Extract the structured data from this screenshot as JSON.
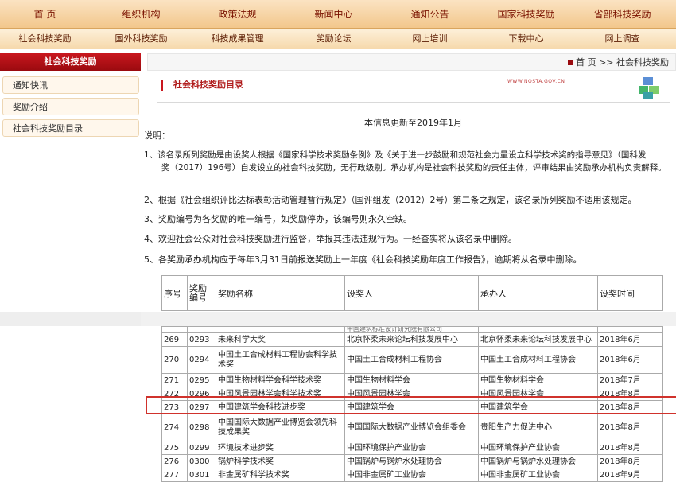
{
  "nav_primary": [
    "首 页",
    "组织机构",
    "政策法规",
    "新闻中心",
    "通知公告",
    "国家科技奖励",
    "省部科技奖励"
  ],
  "nav_secondary": [
    "社会科技奖励",
    "国外科技奖励",
    "科技成果管理",
    "奖励论坛",
    "网上培训",
    "下载中心",
    "网上调查"
  ],
  "sidebar": {
    "title": "社会科技奖励",
    "items": [
      "通知快讯",
      "奖励介绍",
      "社会科技奖励目录"
    ]
  },
  "breadcrumb": {
    "home": "首 页",
    "sep": ">>",
    "current": "社会科技奖励"
  },
  "page_title": "社会科技奖励目录",
  "site_url": "WWW.NOSTA.GOV.CN",
  "update_note": "本信息更新至2019年1月",
  "notes_label": "说明：",
  "notes": [
    "1、该名录所列奖励是由设奖人根据《国家科学技术奖励条例》及《关于进一步鼓励和规范社会力量设立科学技术奖的指导意见》（国科发",
    "奖（2017）196号）自发设立的社会科技奖励，无行政级别。承办机构是社会科技奖励的责任主体，评审结果由奖励承办机构负责解释。",
    "2、根据《社会组织评比达标表彰活动管理暂行规定》（国评组发（2012）2号）第二条之规定，该名录所列奖励不适用该规定。",
    "3、奖励编号为各奖励的唯一编号，如奖励停办，该编号则永久空缺。",
    "4、欢迎社会公众对社会科技奖励进行监督，举报其违法违规行为。一经查实将从该名录中删除。",
    "5、各奖励承办机构应于每年3月31日前报送奖励上一年度《社会科技奖励年度工作报告》，逾期将从名录中删除。"
  ],
  "table": {
    "headers": [
      "序号",
      "奖励编号",
      "奖励名称",
      "设奖人",
      "承办人",
      "设奖时间"
    ],
    "partial_row_text": "中国建筑标准设计研究院有限公司",
    "rows": [
      [
        "269",
        "0293",
        "未来科学大奖",
        "北京怀柔未来论坛科技发展中心",
        "北京怀柔未来论坛科技发展中心",
        "2018年6月"
      ],
      [
        "270",
        "0294",
        "中国土工合成材料工程协会科学技术奖",
        "中国土工合成材料工程协会",
        "中国土工合成材料工程协会",
        "2018年6月"
      ],
      [
        "271",
        "0295",
        "中国生物材料学会科学技术奖",
        "中国生物材料学会",
        "中国生物材料学会",
        "2018年7月"
      ],
      [
        "272",
        "0296",
        "中国风景园林学会科学技术奖",
        "中国风景园林学会",
        "中国风景园林学会",
        "2018年8月"
      ],
      [
        "273",
        "0297",
        "中国建筑学会科技进步奖",
        "中国建筑学会",
        "中国建筑学会",
        "2018年8月"
      ],
      [
        "274",
        "0298",
        "中国国际大数据产业博览会领先科技成果奖",
        "中国国际大数据产业博览会组委会",
        "贵阳生产力促进中心",
        "2018年8月"
      ],
      [
        "275",
        "0299",
        "环境技术进步奖",
        "中国环境保护产业协会",
        "中国环境保护产业协会",
        "2018年8月"
      ],
      [
        "276",
        "0300",
        "锅炉科学技术奖",
        "中国锅炉与锅炉水处理协会",
        "中国锅炉与锅炉水处理协会",
        "2018年8月"
      ],
      [
        "277",
        "0301",
        "非金属矿科学技术奖",
        "中国非金属矿工业协会",
        "中国非金属矿工业协会",
        "2018年9月"
      ]
    ]
  },
  "colors": {
    "accent_red": "#c9171e",
    "highlight_border": "#d0322c",
    "nav_text": "#7a1200"
  }
}
